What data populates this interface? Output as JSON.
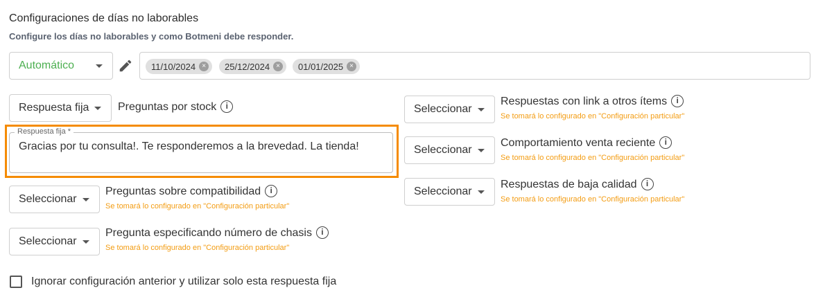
{
  "header": {
    "title": "Configuraciones de días no laborables",
    "subtitle": "Configure los días no laborables y como Botmeni debe responder."
  },
  "mode_select": {
    "value": "Automático"
  },
  "dates": [
    "11/10/2024",
    "25/12/2024",
    "01/01/2025"
  ],
  "left_rows": [
    {
      "select": "Respuesta fija",
      "label": "Preguntas por stock",
      "note": ""
    },
    {
      "select": "Seleccionar",
      "label": "Preguntas sobre compatibilidad",
      "note": "Se tomará lo configurado en \"Configuración particular\""
    },
    {
      "select": "Seleccionar",
      "label": "Pregunta especificando número de chasis",
      "note": "Se tomará lo configurado en \"Configuración particular\""
    }
  ],
  "fixed_response": {
    "legend": "Respuesta fija *",
    "value": "Gracias por tu consulta!. Te responderemos a la brevedad. La tienda!"
  },
  "right_rows": [
    {
      "select": "Seleccionar",
      "label": "Respuestas con link a otros ítems",
      "note": "Se tomará lo configurado en \"Configuración particular\""
    },
    {
      "select": "Seleccionar",
      "label": "Comportamiento venta reciente",
      "note": "Se tomará lo configurado en \"Configuración particular\""
    },
    {
      "select": "Seleccionar",
      "label": "Respuestas de baja calidad",
      "note": "Se tomará lo configurado en \"Configuración particular\""
    }
  ],
  "ignore_checkbox": {
    "label": "Ignorar configuración anterior y utilizar solo esta respuesta fija",
    "checked": false
  },
  "colors": {
    "accent_green": "#4caf50",
    "note_orange": "#f39c12",
    "highlight_orange": "#f58b00"
  }
}
